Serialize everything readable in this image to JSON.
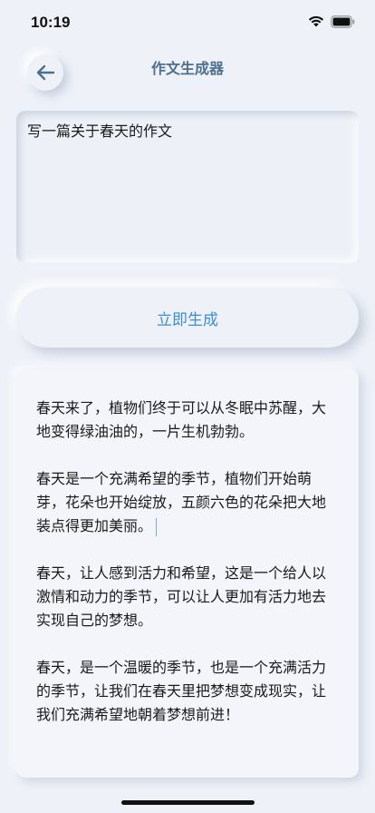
{
  "status_bar": {
    "time": "10:19",
    "icons": [
      "wifi-icon",
      "battery-icon"
    ]
  },
  "header": {
    "title": "作文生成器",
    "back_icon": "arrow-left-icon"
  },
  "prompt": {
    "value": "写一篇关于春天的作文"
  },
  "generate_button": {
    "label": "立即生成"
  },
  "output": {
    "paragraphs": [
      "春天来了，植物们终于可以从冬眠中苏醒，大地变得绿油油的，一片生机勃勃。",
      "春天是一个充满希望的季节，植物们开始萌芽，花朵也开始绽放，五颜六色的花朵把大地装点得更加美丽。",
      "春天，让人感到活力和希望，这是一个给人以激情和动力的季节，可以让人更加有活力地去实现自己的梦想。",
      "春天，是一个温暖的季节，也是一个充满活力的季节，让我们在春天里把梦想变成现实，让我们充满希望地朝着梦想前进！"
    ]
  },
  "colors": {
    "background": "#eef1f8",
    "title": "#4f6f8e",
    "accent": "#3a8fd6"
  }
}
